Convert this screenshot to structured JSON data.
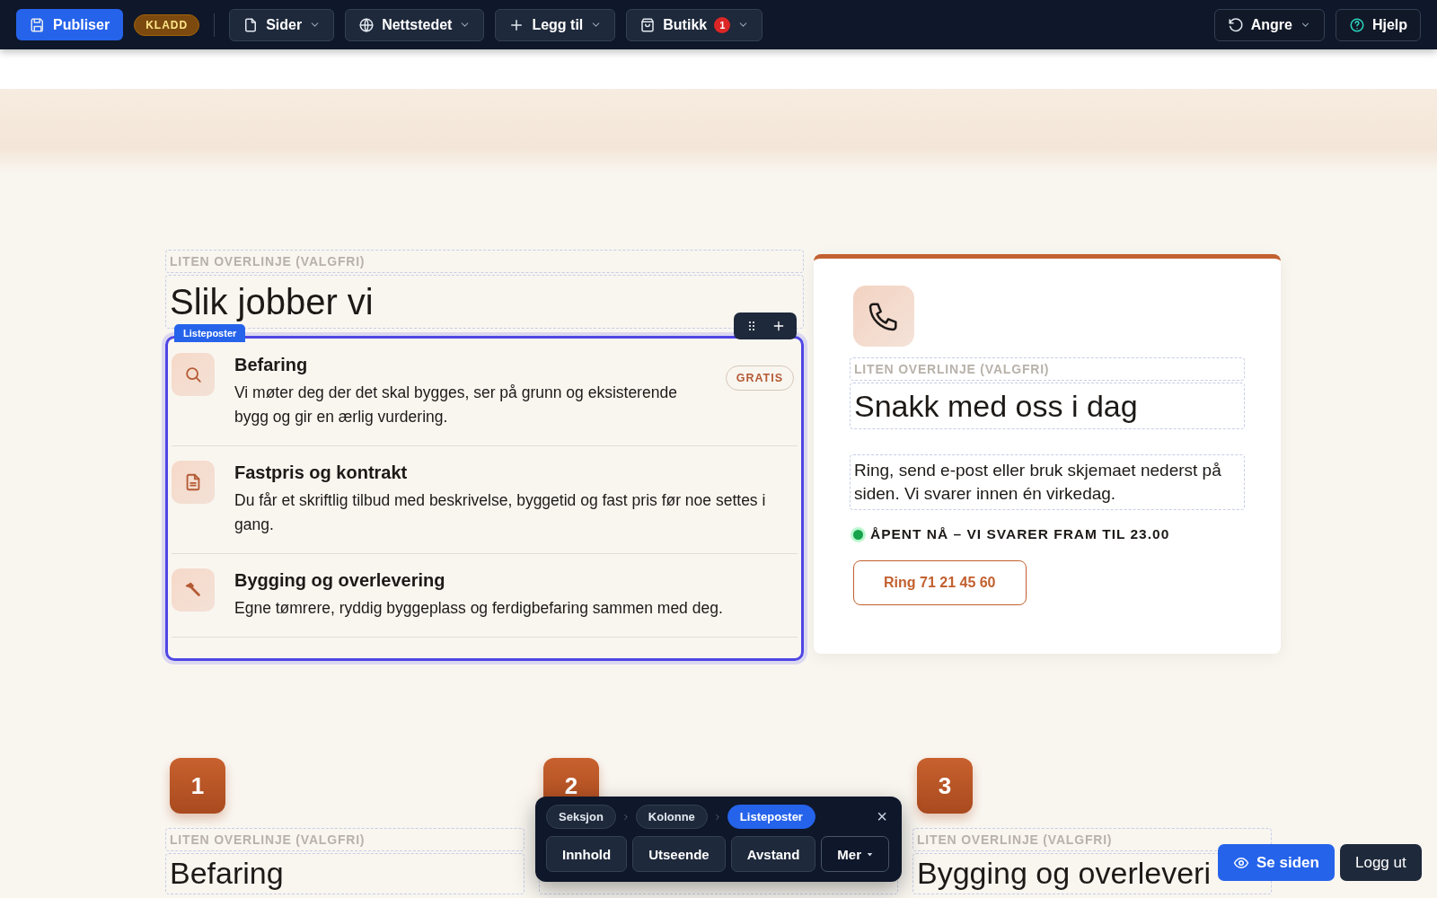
{
  "toolbar": {
    "publish": "Publiser",
    "status_badge": "KLADD",
    "menus": [
      {
        "label": "Sider"
      },
      {
        "label": "Nettstedet"
      },
      {
        "label": "Legg til"
      },
      {
        "label": "Butikk",
        "badge": "1"
      }
    ],
    "right": [
      {
        "label": "Angre",
        "dropdown": true
      },
      {
        "label": "Hjelp",
        "dropdown": false
      }
    ]
  },
  "section": {
    "overline": "LITEN OVERLINJE (VALGFRI)",
    "heading": "Slik jobber vi",
    "list_tag": "Listeposter",
    "list_selected": true,
    "items": [
      {
        "title": "Befaring",
        "text": "Vi møter deg der det skal bygges, ser på grunn og eksisterende bygg og gir en ærlig vurdering.",
        "badge": "GRATIS"
      },
      {
        "title": "Fastpris og kontrakt",
        "text": "Du får et skriftlig tilbud med beskrivelse, byggetid og fast pris før noe settes i gang."
      },
      {
        "title": "Bygging og overlevering",
        "text": "Egne tømrere, ryddig byggeplass og ferdigbefaring sammen med deg."
      }
    ]
  },
  "contact_card": {
    "overline": "LITEN OVERLINJE (VALGFRI)",
    "heading": "Snakk med oss i dag",
    "text": "Ring, send e-post eller bruk skjemaet nederst på siden. Vi svarer innen én virkedag.",
    "status": "ÅPENT NÅ – VI SVARER FRAM TIL 23.00",
    "open": true,
    "button": "Ring 71 21 45 60"
  },
  "steps": [
    {
      "number": "1",
      "overline": "LITEN OVERLINJE (VALGFRI)",
      "heading": "Befaring"
    },
    {
      "number": "2"
    },
    {
      "number": "3",
      "overline": "LITEN OVERLINJE (VALGFRI)",
      "heading": "Bygging og overleveri"
    }
  ],
  "edit_panel": {
    "breadcrumb": [
      {
        "label": "Seksjon",
        "selected": false
      },
      {
        "label": "Kolonne",
        "selected": false
      },
      {
        "label": "Listeposter",
        "selected": true
      }
    ],
    "close": "×",
    "tabs": [
      {
        "label": "Innhold",
        "dropdown": false
      },
      {
        "label": "Utseende",
        "dropdown": false
      },
      {
        "label": "Avstand",
        "dropdown": false
      },
      {
        "label": "Mer",
        "dropdown": true
      }
    ]
  },
  "floating": {
    "view": "Se siden",
    "logout": "Logg ut"
  }
}
